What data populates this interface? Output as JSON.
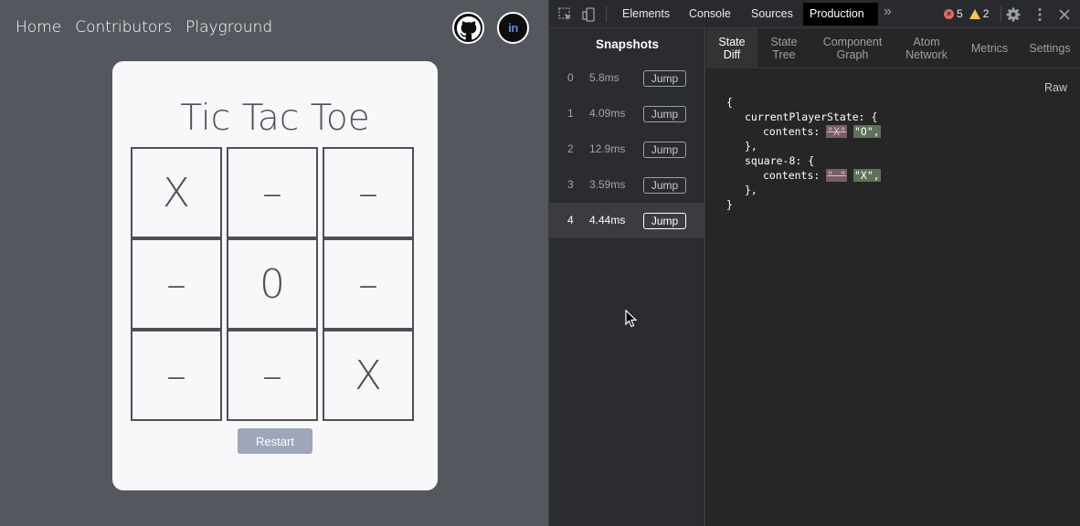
{
  "app": {
    "nav": [
      "Home",
      "Contributors",
      "Playground"
    ],
    "title": "Tic Tac Toe",
    "board": [
      "X",
      "–",
      "–",
      "–",
      "0",
      "–",
      "–",
      "–",
      "X"
    ],
    "restart_label": "Restart",
    "icons": {
      "github": "github-icon",
      "linkedin": "linkedin-icon",
      "linkedin_text": "in"
    }
  },
  "devtools": {
    "tabs": [
      "Elements",
      "Console",
      "Sources",
      "Production"
    ],
    "active_tab": "Production",
    "more_label": "»",
    "errors": "5",
    "warnings": "2",
    "snapshots_title": "Snapshots",
    "snapshots": [
      {
        "index": "0",
        "time": "5.8ms",
        "jump": "Jump"
      },
      {
        "index": "1",
        "time": "4.09ms",
        "jump": "Jump"
      },
      {
        "index": "2",
        "time": "12.9ms",
        "jump": "Jump"
      },
      {
        "index": "3",
        "time": "3.59ms",
        "jump": "Jump"
      },
      {
        "index": "4",
        "time": "4.44ms",
        "jump": "Jump"
      }
    ],
    "active_snapshot": "4",
    "detail_tabs": [
      "State Diff",
      "State Tree",
      "Component Graph",
      "Atom Network",
      "Metrics",
      "Settings"
    ],
    "active_detail_tab": "State Diff",
    "raw_label": "Raw",
    "diff": {
      "open": "{",
      "key1": "currentPlayerState: {",
      "contents": "contents: ",
      "old1": "\"X\"",
      "new1": "\"O\",",
      "close_inner": "},",
      "key2": "square-8: {",
      "old2": "\"–\"",
      "new2": "\"X\",",
      "close": "}"
    }
  },
  "colors": {
    "app_bg": "#55575e",
    "card_bg": "#f8f8fb",
    "restart_bg": "#a0a6b9",
    "diff_removed": "#7a5d64",
    "diff_added": "#5e7257"
  }
}
